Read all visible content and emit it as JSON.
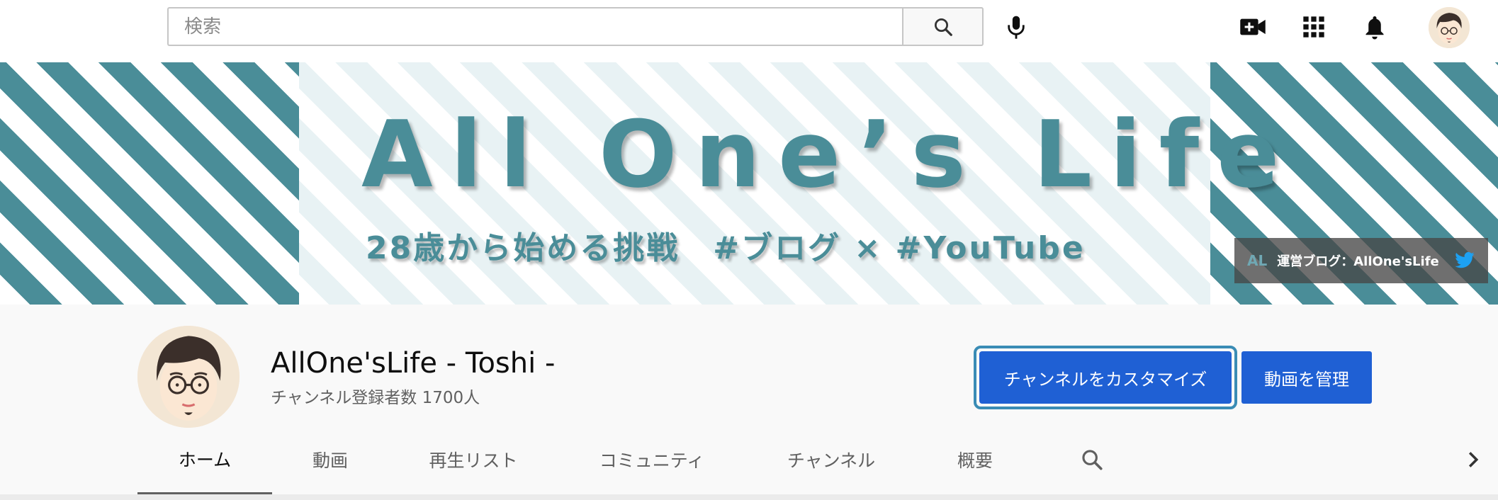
{
  "search": {
    "placeholder": "検索"
  },
  "icons": {
    "search": "search-icon",
    "mic": "mic-icon",
    "create": "video-camera-plus-icon",
    "apps": "apps-grid-icon",
    "notifications": "bell-icon",
    "twitter": "twitter-icon"
  },
  "banner": {
    "title": "All One’s Life",
    "subtitle": "28歳から始める挑戦　#ブログ × #YouTube",
    "blog_logo": "AL",
    "blog_link_label": "運営ブログ：AllOne'sLife"
  },
  "channel": {
    "name": "AllOne'sLife - Toshi -",
    "subscribers": "チャンネル登録者数 1700人",
    "customize_label": "チャンネルをカスタマイズ",
    "manage_label": "動画を管理"
  },
  "tabs": [
    {
      "label": "ホーム",
      "active": true
    },
    {
      "label": "動画",
      "active": false
    },
    {
      "label": "再生リスト",
      "active": false
    },
    {
      "label": "コミュニティ",
      "active": false
    },
    {
      "label": "チャンネル",
      "active": false
    },
    {
      "label": "概要",
      "active": false
    }
  ],
  "colors": {
    "banner_teal": "#4a8d98",
    "primary_button": "#1f60d4",
    "focus_ring": "#3a8cb5",
    "twitter": "#1da1f2"
  }
}
